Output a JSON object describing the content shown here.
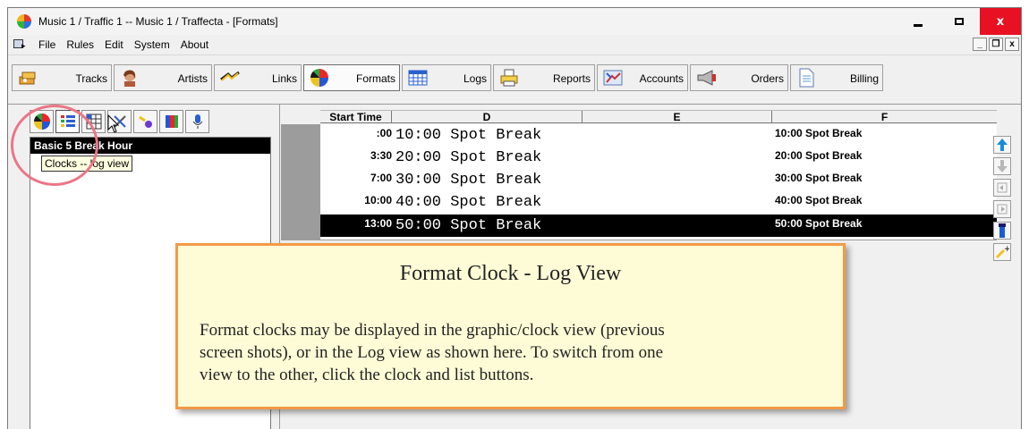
{
  "window": {
    "title": "Music 1 / Traffic 1 -- Music 1 / Traffecta - [Formats]",
    "close_glyph": "x"
  },
  "menu": {
    "items": [
      "File",
      "Rules",
      "Edit",
      "System",
      "About"
    ]
  },
  "mdi": {
    "min": "_",
    "restore": "❐",
    "close": "x"
  },
  "toolbar": {
    "tabs": [
      {
        "label": "Tracks",
        "icon": "tracks-icon"
      },
      {
        "label": "Artists",
        "icon": "artist-icon"
      },
      {
        "label": "Links",
        "icon": "links-icon"
      },
      {
        "label": "Formats",
        "icon": "formats-icon",
        "active": true
      },
      {
        "label": "Logs",
        "icon": "logs-icon"
      },
      {
        "label": "Reports",
        "icon": "printer-icon"
      },
      {
        "label": "Accounts",
        "icon": "accounts-icon"
      },
      {
        "label": "Orders",
        "icon": "megaphone-icon"
      },
      {
        "label": "Billing",
        "icon": "billing-icon"
      }
    ]
  },
  "left_panel": {
    "selected_item": "Basic 5 Break Hour",
    "tooltip": "Clocks -- log view"
  },
  "grid": {
    "headers": [
      "Start Time",
      "D",
      "E",
      "F"
    ],
    "rows": [
      {
        "start": ":00",
        "d": "10:00 Spot Break",
        "f": "10:00 Spot Break"
      },
      {
        "start": "3:30",
        "d": "20:00 Spot Break",
        "f": "20:00 Spot Break"
      },
      {
        "start": "7:00",
        "d": "30:00 Spot Break",
        "f": "30:00 Spot Break"
      },
      {
        "start": "10:00",
        "d": "40:00 Spot Break",
        "f": "40:00 Spot Break"
      },
      {
        "start": "13:00",
        "d": "50:00 Spot Break",
        "f": "50:00 Spot Break",
        "selected": true
      }
    ]
  },
  "callout": {
    "title": "Format Clock - Log View",
    "line1": "Format clocks may be displayed in the graphic/clock view (previous",
    "line2": "screen shots), or in the Log view as shown here. To switch from one",
    "line3": "view to the other, click the clock and list buttons."
  },
  "colors": {
    "close_red": "#e81123",
    "highlight_circle": "#ec7686",
    "callout_border": "#f39a45",
    "callout_bg": "#fefcd6",
    "selection": "#000000"
  }
}
